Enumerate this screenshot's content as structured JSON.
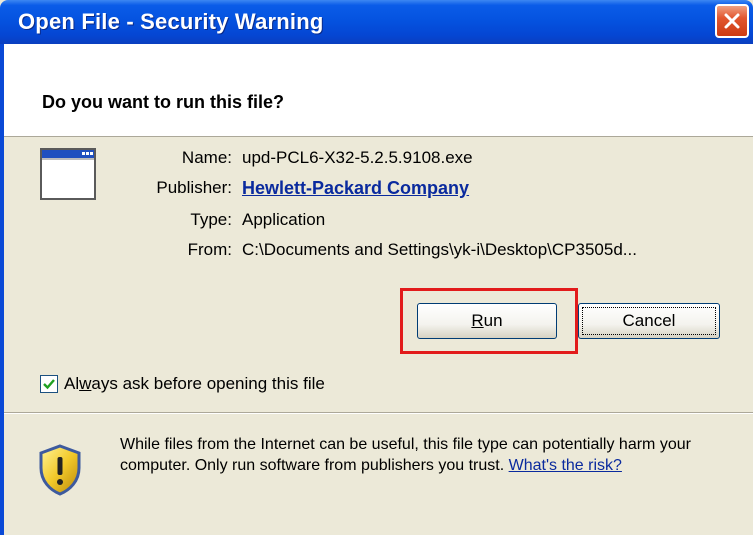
{
  "window": {
    "title": "Open File - Security Warning",
    "close_symbol": "✕"
  },
  "header": {
    "question": "Do you want to run this file?"
  },
  "file": {
    "icon": "application-window-icon",
    "rows": [
      {
        "label": "Name:",
        "value": "upd-PCL6-X32-5.2.5.9108.exe"
      },
      {
        "label": "Publisher:",
        "value": "Hewlett-Packard Company"
      },
      {
        "label": "Type:",
        "value": "Application"
      },
      {
        "label": "From:",
        "value": "C:\\Documents and Settings\\yk-i\\Desktop\\CP3505d..."
      }
    ]
  },
  "buttons": {
    "run_label": "Run",
    "cancel_label": "Cancel"
  },
  "checkbox": {
    "label_pre": "Al",
    "label_mnemonic": "w",
    "label_post": "ays ask before opening this file",
    "checked": true
  },
  "warning": {
    "text": "While files from the Internet can be useful, this file type can potentially harm your computer. Only run software from publishers you trust.",
    "link": "What's the risk?",
    "icon": "security-shield-icon"
  },
  "colors": {
    "titlebar": "#0553e0",
    "highlight": "#e21b1b",
    "link": "#0a2a9e"
  }
}
